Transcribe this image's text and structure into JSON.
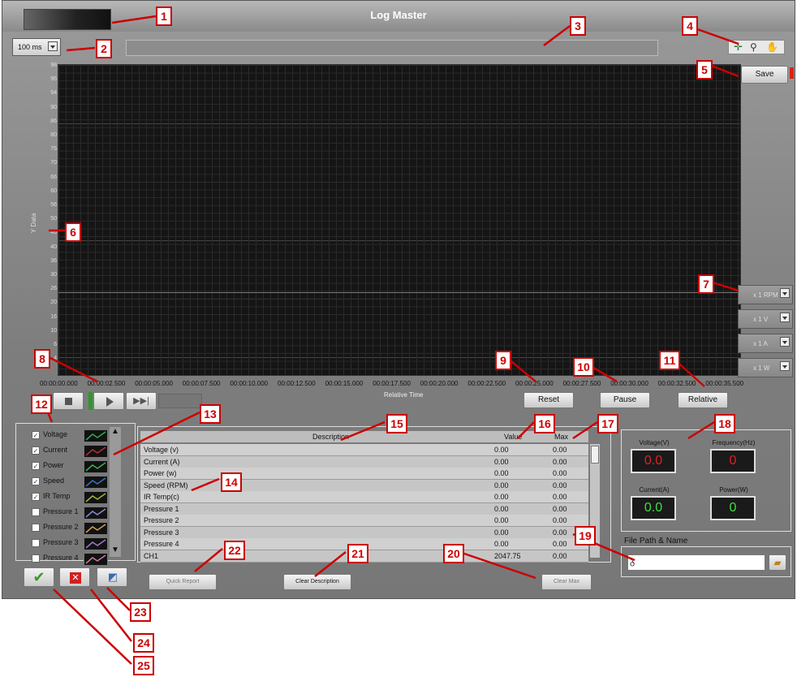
{
  "window": {
    "title": "Log Master"
  },
  "toolbar": {
    "interval": "100 ms",
    "save_label": "Save"
  },
  "plot": {
    "y_axis_label": "Y Data",
    "y_ticks": [
      "98",
      "96",
      "94",
      "90",
      "86",
      "80",
      "76",
      "70",
      "66",
      "60",
      "56",
      "50",
      "46",
      "40",
      "36",
      "30",
      "26",
      "20",
      "16",
      "10",
      "6",
      "4"
    ],
    "x_ticks": [
      "00:00:00.000",
      "00:00:02.500",
      "00:00:05.000",
      "00:00:07.500",
      "00:00:10.000",
      "00:00:12.500",
      "00:00:15.000",
      "00:00:17.500",
      "00:00:20.000",
      "00:00:22.500",
      "00:00:25.000",
      "00:00:27.500",
      "00:00:30.000",
      "00:00:32.500",
      "00:00:35.500"
    ],
    "x_axis_label": "Relative Time"
  },
  "scales": [
    {
      "label": "x 1  RPM"
    },
    {
      "label": "x 1  V"
    },
    {
      "label": "x 1  A"
    },
    {
      "label": "x 1  W"
    }
  ],
  "controls": {
    "reset": "Reset",
    "pause": "Pause",
    "relative": "Relative"
  },
  "channels": [
    {
      "label": "Voltage",
      "checked": true,
      "color": "#2fa84f"
    },
    {
      "label": "Current",
      "checked": true,
      "color": "#b0303a"
    },
    {
      "label": "Power",
      "checked": true,
      "color": "#3cb050"
    },
    {
      "label": "Speed",
      "checked": true,
      "color": "#3a70c8"
    },
    {
      "label": "IR Temp",
      "checked": true,
      "color": "#9ab838"
    },
    {
      "label": "Pressure 1",
      "checked": false,
      "color": "#8a8ad0"
    },
    {
      "label": "Pressure 2",
      "checked": false,
      "color": "#c8a050"
    },
    {
      "label": "Pressure 3",
      "checked": false,
      "color": "#9a7ac8"
    },
    {
      "label": "Pressure 4",
      "checked": false,
      "color": "#c87a9a"
    }
  ],
  "table": {
    "headers": {
      "description": "Description",
      "value": "Value",
      "max": "Max"
    },
    "rows": [
      {
        "name": "Voltage (v)",
        "value": "0.00",
        "max": "0.00"
      },
      {
        "name": "Current (A)",
        "value": "0.00",
        "max": "0.00"
      },
      {
        "name": "Power (w)",
        "value": "0.00",
        "max": "0.00"
      },
      {
        "name": "Speed (RPM)",
        "value": "0.00",
        "max": "0.00"
      },
      {
        "name": "IR Temp(c)",
        "value": "0.00",
        "max": "0.00"
      },
      {
        "name": "Pressure 1",
        "value": "0.00",
        "max": "0.00"
      },
      {
        "name": "Pressure 2",
        "value": "0.00",
        "max": "0.00"
      },
      {
        "name": "Pressure 3",
        "value": "0.00",
        "max": "0.00"
      },
      {
        "name": "Pressure 4",
        "value": "0.00",
        "max": "0.00"
      },
      {
        "name": "CH1",
        "value": "2047.75",
        "max": "0.00"
      }
    ]
  },
  "buttons": {
    "quick_report": "Quick Report",
    "clear_description": "Clear Description",
    "clear_max": "Clear Max"
  },
  "meters": [
    {
      "label": "Voltage(V)",
      "value": "0.0",
      "color": "#e02020"
    },
    {
      "label": "Frequency(Hz)",
      "value": "0",
      "color": "#e02020"
    },
    {
      "label": "Current(A)",
      "value": "0.0",
      "color": "#40e040"
    },
    {
      "label": "Power(W)",
      "value": "0",
      "color": "#40e040"
    }
  ],
  "file": {
    "label": "File Path & Name",
    "path": ""
  },
  "callouts": [
    "1",
    "2",
    "3",
    "4",
    "5",
    "6",
    "7",
    "8",
    "9",
    "10",
    "11",
    "12",
    "13",
    "14",
    "15",
    "16",
    "17",
    "18",
    "19",
    "20",
    "21",
    "22",
    "23",
    "24",
    "25"
  ]
}
